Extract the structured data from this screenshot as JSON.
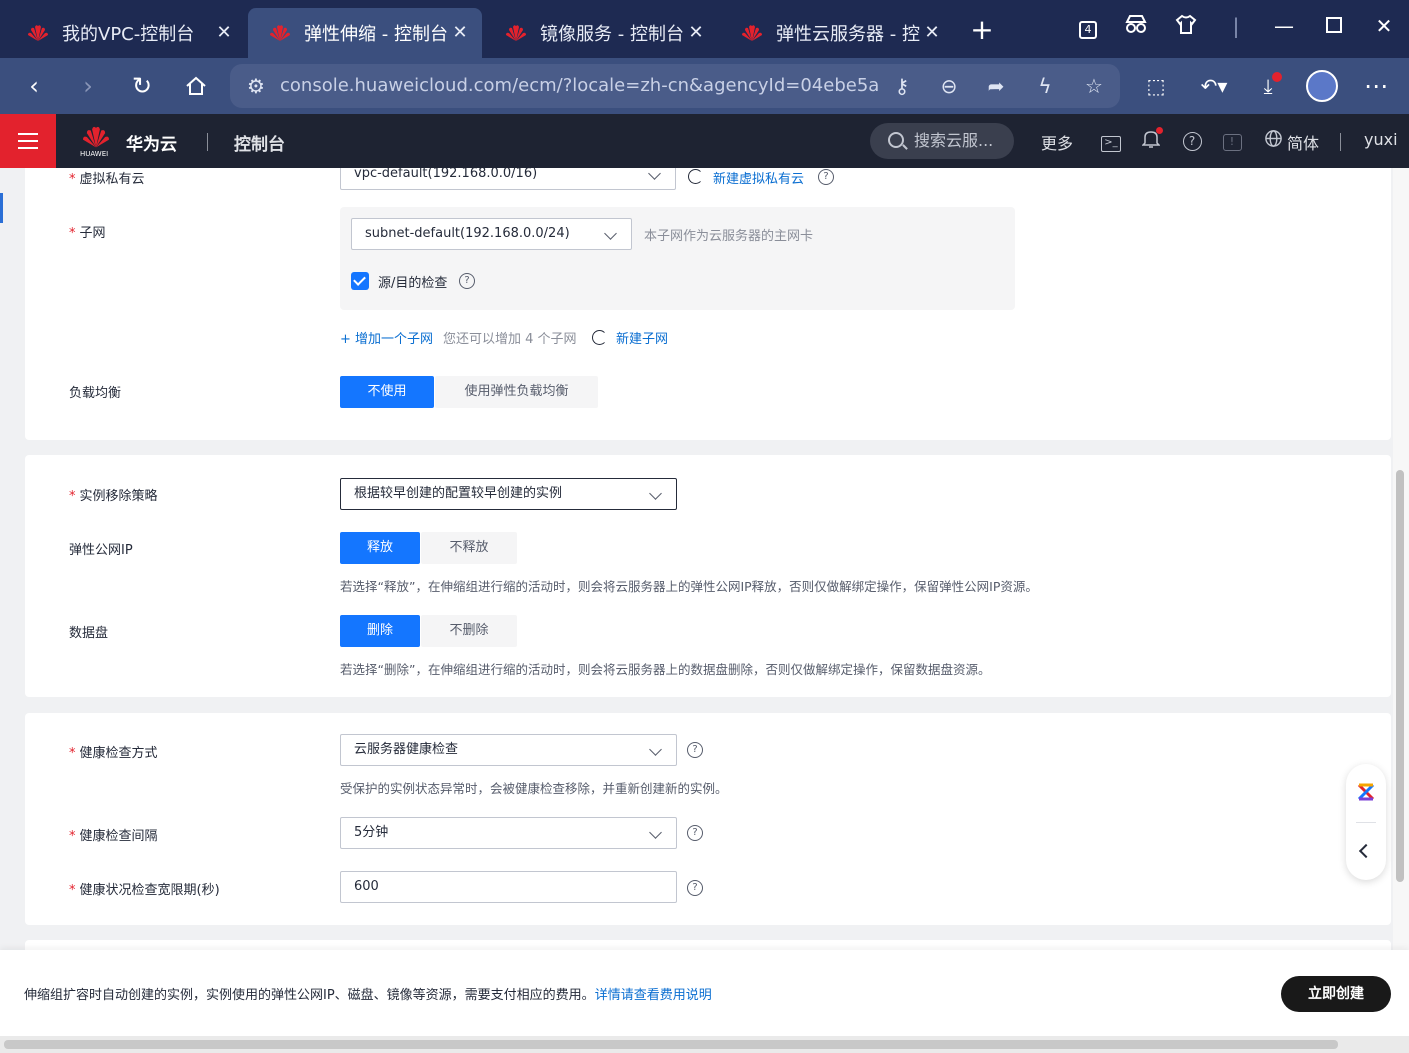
{
  "browser": {
    "tabs": [
      {
        "title": "我的VPC-控制台",
        "active": false
      },
      {
        "title": "弹性伸缩 - 控制台",
        "active": true
      },
      {
        "title": "镜像服务 - 控制台",
        "active": false
      },
      {
        "title": "弹性云服务器 - 控",
        "active": false
      }
    ],
    "tab_count": "4",
    "url": "console.huaweicloud.com/ecm/?locale=zh-cn&agencyId=04ebe5a..."
  },
  "header": {
    "logo_text": "HUAWEI",
    "brand": "华为云",
    "console": "控制台",
    "search_placeholder": "搜索云服...",
    "more": "更多",
    "language": "简体",
    "user": "yuxi"
  },
  "network": {
    "vpc_label": "虚拟私有云",
    "vpc_value": "vpc-default(192.168.0.0/16)",
    "vpc_create_link": "新建虚拟私有云",
    "subnet_label": "子网",
    "subnet_value": "subnet-default(192.168.0.0/24)",
    "subnet_hint": "本子网作为云服务器的主网卡",
    "source_dest_check": "源/目的检查",
    "add_subnet": "+ 增加一个子网",
    "add_subnet_hint": "您还可以增加 4 个子网",
    "new_subnet": "新建子网",
    "lb_label": "负载均衡",
    "lb_options": [
      "不使用",
      "使用弹性负载均衡"
    ]
  },
  "removal": {
    "policy_label": "实例移除策略",
    "policy_value": "根据较早创建的配置较早创建的实例",
    "eip_label": "弹性公网IP",
    "eip_options": [
      "释放",
      "不释放"
    ],
    "eip_desc": "若选择“释放”，在伸缩组进行缩的活动时，则会将云服务器上的弹性公网IP释放，否则仅做解绑定操作，保留弹性公网IP资源。",
    "disk_label": "数据盘",
    "disk_options": [
      "删除",
      "不删除"
    ],
    "disk_desc": "若选择“删除”，在伸缩组进行缩的活动时，则会将云服务器上的数据盘删除，否则仅做解绑定操作，保留数据盘资源。"
  },
  "health": {
    "method_label": "健康检查方式",
    "method_value": "云服务器健康检查",
    "method_desc": "受保护的实例状态异常时，会被健康检查移除，并重新创建新的实例。",
    "interval_label": "健康检查间隔",
    "interval_value": "5分钟",
    "grace_label": "健康状况检查宽限期(秒)",
    "grace_value": "600"
  },
  "footer": {
    "note": "伸缩组扩容时自动创建的实例，实例使用的弹性公网IP、磁盘、镜像等资源，需要支付相应的费用。",
    "note_link": "详情请查看费用说明",
    "create_button": "立即创建"
  }
}
